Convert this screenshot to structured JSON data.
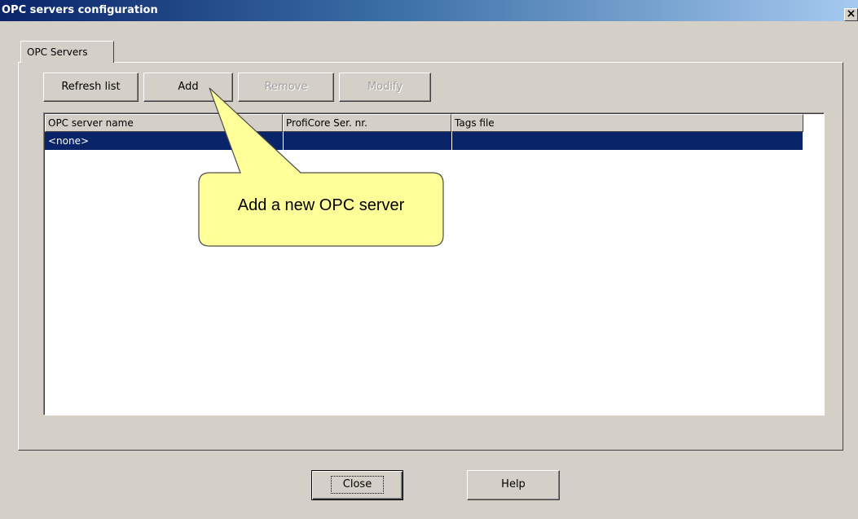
{
  "window": {
    "title": "OPC servers configuration",
    "close_glyph": "×"
  },
  "tabs": [
    {
      "label": "OPC Servers",
      "selected": true
    }
  ],
  "toolbar": {
    "refresh_label": "Refresh list",
    "add_label": "Add",
    "remove_label": "Remove",
    "modify_label": "Modify"
  },
  "table": {
    "columns": [
      "OPC server name",
      "ProfiCore Ser. nr.",
      "Tags file"
    ],
    "rows": [
      {
        "name": "<none>",
        "serial": "",
        "tags_file": "",
        "selected": true
      }
    ]
  },
  "footer": {
    "close_label": "Close",
    "help_label": "Help"
  },
  "callout": {
    "text": "Add a new OPC server"
  },
  "colors": {
    "window_bg": "#d4d0c8",
    "title_start": "#0a246a",
    "title_end": "#a6caf0",
    "selection": "#0a246a",
    "callout_fill": "#ffff99",
    "callout_stroke": "#4d4d4d"
  }
}
